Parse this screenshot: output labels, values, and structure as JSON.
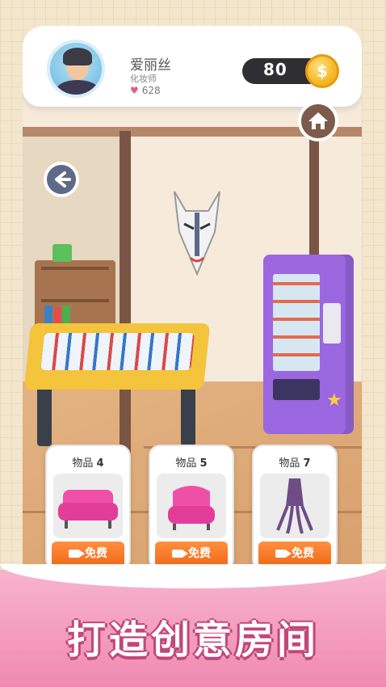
{
  "profile": {
    "name": "爱丽丝",
    "role": "化妆师",
    "likes": "628"
  },
  "currency": {
    "coins": "80",
    "coin_symbol": "$"
  },
  "items": [
    {
      "title_prefix": "物品",
      "number": "4",
      "button_label": "免费",
      "object": "pink sofa"
    },
    {
      "title_prefix": "物品",
      "number": "5",
      "button_label": "免费",
      "object": "pink armchair"
    },
    {
      "title_prefix": "物品",
      "number": "7",
      "button_label": "免费",
      "object": "purple squid"
    }
  ],
  "banner": {
    "slogan": "打造创意房间"
  },
  "icons": {
    "home": "home-icon",
    "back": "back-arrow-icon",
    "video": "video-camera-icon",
    "heart": "heart-icon"
  },
  "colors": {
    "accent_orange": "#f26a1b",
    "banner_pink": "#f08ab0",
    "heart_pink": "#e85a8b",
    "coin_gold": "#f4b21b"
  }
}
